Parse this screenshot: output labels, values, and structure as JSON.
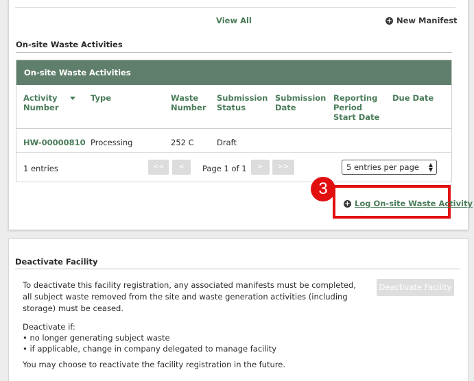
{
  "manifests": {
    "view_all": "View All",
    "new_manifest": "New Manifest"
  },
  "onsite": {
    "section_title": "On-site Waste Activities",
    "table_title": "On-site Waste Activities",
    "columns": [
      "Activity Number",
      "Type",
      "Waste Number",
      "Submission Status",
      "Submission Date",
      "Reporting Period Start Date",
      "Due Date"
    ],
    "rows": [
      {
        "activity_number": "HW-00000810",
        "type": "Processing",
        "waste_number": "252 C",
        "submission_status": "Draft",
        "submission_date": "",
        "reporting_period_start": "",
        "due_date": ""
      }
    ],
    "entries_label": "1 entries",
    "pagination": {
      "first": "<<",
      "prev": "<",
      "page_label": "Page 1 of 1",
      "next": ">",
      "last": ">>"
    },
    "page_size": "5 entries per page",
    "log_link": "Log On-site Waste Activity"
  },
  "annotation": {
    "step": "3",
    "color": "#e20f0f"
  },
  "deactivate": {
    "section_title": "Deactivate Facility",
    "description": "To deactivate this facility registration, any associated manifests must be completed, all subject waste removed from the site and waste generation activities (including storage) must be ceased.",
    "button": "Deactivate Facility",
    "if_label": "Deactivate if:",
    "bullets": [
      "no longer generating subject waste",
      "if applicable, change in company delegated to manage facility"
    ],
    "footer": "You may choose to reactivate the facility registration in the future."
  },
  "colors": {
    "accent_green": "#4a7c59",
    "header_green": "#5f7f6c"
  },
  "icons": {
    "plus": "plus-circle-icon",
    "sort": "sort-down-icon",
    "select": "select-arrows-icon"
  }
}
